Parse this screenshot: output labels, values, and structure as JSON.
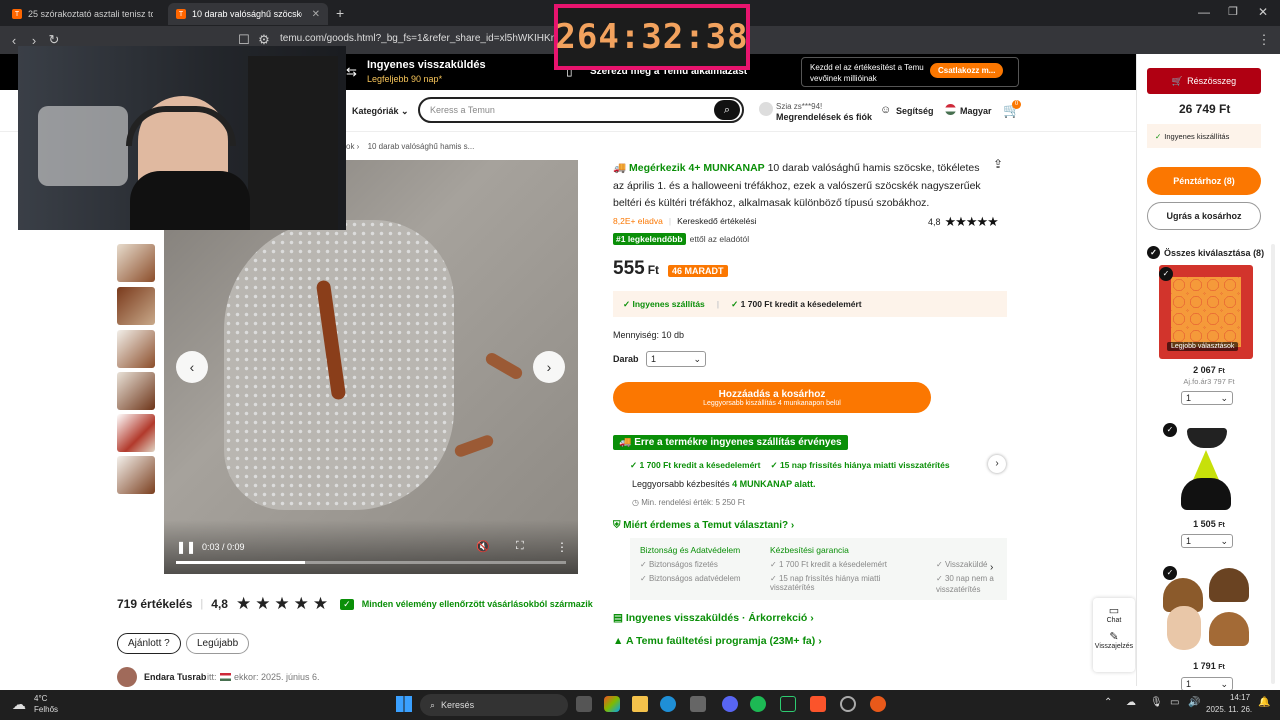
{
  "browser": {
    "tabs": [
      {
        "label": "25 szórakoztató asztali tenisz tojás s..."
      },
      {
        "label": "10 darab valósághű szöcske tök..."
      }
    ],
    "url": "temu.com/goods.html?_bg_fs=1&refer_share_id=xl5hWKIHKnYm8...ystem_share&from_share=1&...",
    "new_tab": "+"
  },
  "timer": "264:32:38",
  "topstrip": {
    "free_return_title": "Ingyenes visszaküldés",
    "free_return_sub": "Legfeljebb 90 nap*",
    "app_text": "Szerezd meg a Temu alkalmazást",
    "promo_text": "Kezdd el az értékesítést a Temu vevőinek millióinak",
    "promo_btn": "Csatlakozz m..."
  },
  "nav": {
    "categories": "Kategóriák",
    "search_placeholder": "Keress a Temun",
    "greeting": "Szia zs***94!",
    "orders": "Megrendelések és fiók",
    "help": "Segítség",
    "language": "Magyar",
    "cart_count": "0"
  },
  "breadcrumb": {
    "prev": "ok",
    "current": "10 darab valósághű hamis s..."
  },
  "video": {
    "time": "0:03 / 0:09",
    "progress": 0.33
  },
  "product": {
    "delivery_badge": "Megérkezik 4+ MUNKANAP",
    "title": "10 darab valósághű hamis szöcske, tökéletes az április 1. és a halloweeni tréfákhoz, ezek a valószerű szöcskék nagyszerűek beltéri és kültéri tréfákhoz, alkalmasak különböző típusú szobákhoz.",
    "sold": "8,2E+ eladva",
    "seller_rating_label": "Kereskedő értékelési",
    "rating": "4,8",
    "bestseller_badge": "#1 legkelendőbb",
    "bestseller_text": "ettől az eladótól",
    "price": "555",
    "currency": "Ft",
    "stock_badge": "46 MARADT",
    "free_shipping": "Ingyenes szállítás",
    "credit": "1 700 Ft kredit a késedelemért",
    "quantity_label": "Mennyiség: 10 db",
    "darab_label": "Darab",
    "darab_value": "1",
    "add_to_cart": "Hozzáadás a kosárhoz",
    "add_to_cart_sub": "Leggyorsabb kiszállítás 4 munkanapon belül",
    "free_shipping_banner": "Erre a termékre ingyenes szállítás érvényes",
    "shipping_item1": "1 700 Ft kredit a késedelemért",
    "shipping_item2": "15 nap frissítés hiánya miatti visszatérítés",
    "fastest_delivery": "Leggyorsabb kézbesítés",
    "fastest_days": "4 MUNKANAP alatt.",
    "min_order": "Min. rendelési érték: 5 250 Ft",
    "why_temu": "Miért érdemes a Temut választani?",
    "security_title": "Biztonság és Adatvédelem",
    "security_items": [
      "Biztonságos fizetés",
      "Biztonságos adatvédelem"
    ],
    "delivery_title": "Kézbesítési garancia",
    "delivery_items": [
      "1 700 Ft kredit a késedelemért",
      "15 nap frissítés hiánya miatti visszatérítés"
    ],
    "return_partial": "Visszaküldé",
    "return_partial2": "30 nap nem a",
    "return_partial3": "visszatérítés",
    "free_returns_line": "Ingyenes visszaküldés · Árkorrekció",
    "farming_line": "A Temu faültetési programja (23M+ fa)"
  },
  "reviews": {
    "count": "719 értékelés",
    "rating": "4,8",
    "verified": "Minden vélemény ellenőrzött vásárlásokból származik",
    "filter1": "Ajánlott",
    "filter2": "Legújabb",
    "reviewer": "Endara Tusrab",
    "reviewer_meta": "itt: ",
    "reviewer_date": "ekkor: 2025. június 6."
  },
  "cart": {
    "partial_btn": "Részösszeg",
    "subtotal": "26 749 Ft",
    "free_shipping": "Ingyenes kiszállítás",
    "checkout": "Pénztárhoz (8)",
    "goto_cart": "Ugrás a kosárhoz",
    "select_all": "Összes kiválasztása (8)",
    "best_choice": "Legjobb választások",
    "item1_price": "2 067",
    "item1_old": "Aj.fo.ár3 797 Ft",
    "item1_qty": "1",
    "item2_price": "1 505",
    "item2_qty": "1",
    "item3_price": "1 791",
    "item3_qty": "1",
    "ft": "Ft"
  },
  "side_float": {
    "chat": "Chat",
    "feedback": "Visszajelzés"
  },
  "taskbar": {
    "weather_temp": "4°C",
    "weather_desc": "Felhős",
    "search": "Keresés",
    "time": "14:17",
    "date": "2025. 11. 26."
  },
  "colors": {
    "accent": "#fb7701",
    "green": "#0a8f08",
    "timer_border": "#e8146e"
  }
}
